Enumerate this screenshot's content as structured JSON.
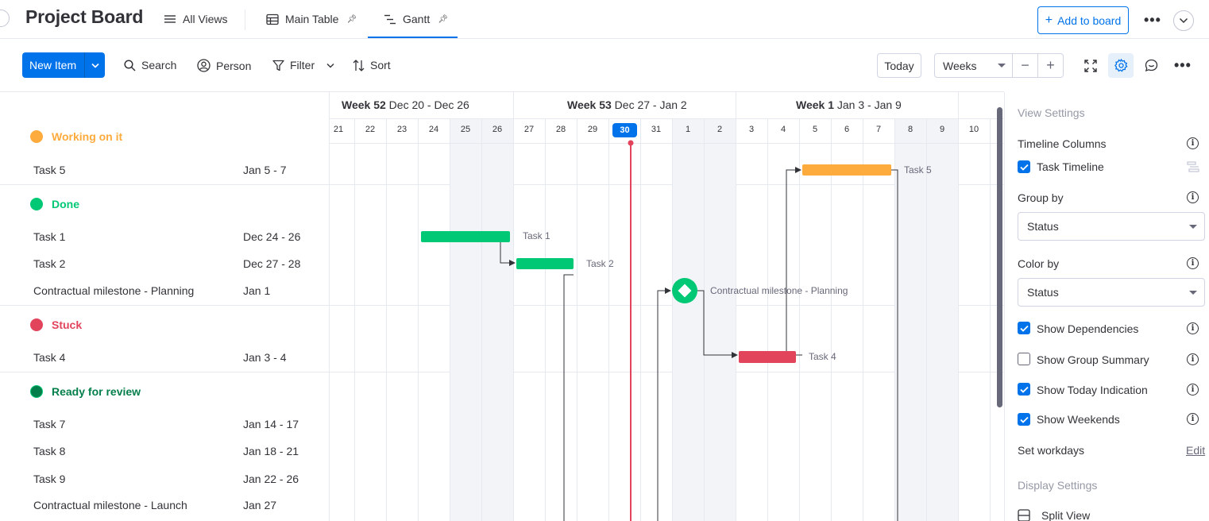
{
  "header": {
    "title": "Project Board",
    "views": [
      {
        "label": "All Views"
      },
      {
        "label": "Main Table"
      },
      {
        "label": "Gantt"
      }
    ],
    "add_to_board": "Add to board"
  },
  "toolbar": {
    "new_item": "New Item",
    "search": "Search",
    "person": "Person",
    "filter": "Filter",
    "sort": "Sort",
    "today": "Today",
    "scale": "Weeks"
  },
  "weeks": [
    {
      "name": "Week 52",
      "range": "Dec 20 - Dec 26"
    },
    {
      "name": "Week 53",
      "range": "Dec 27 - Jan 2"
    },
    {
      "name": "Week 1",
      "range": "Jan 3 - Jan 9"
    }
  ],
  "days": [
    "21",
    "22",
    "23",
    "24",
    "25",
    "26",
    "27",
    "28",
    "29",
    "30",
    "31",
    "1",
    "2",
    "3",
    "4",
    "5",
    "6",
    "7",
    "8",
    "9",
    "10"
  ],
  "today_day": "30",
  "groups": [
    {
      "name": "Working on it",
      "color": "#fdab3d",
      "items": [
        {
          "name": "Task 5",
          "date": "Jan 5 - 7"
        }
      ]
    },
    {
      "name": "Done",
      "color": "#00c875",
      "items": [
        {
          "name": "Task 1",
          "date": "Dec 24 - 26"
        },
        {
          "name": "Task 2",
          "date": "Dec 27 - 28"
        },
        {
          "name": "Contractual milestone - Planning",
          "date": "Jan 1"
        }
      ]
    },
    {
      "name": "Stuck",
      "color": "#e2445c",
      "items": [
        {
          "name": "Task 4",
          "date": "Jan 3 - 4"
        }
      ]
    },
    {
      "name": "Ready for review",
      "color": "#037f4c",
      "items": [
        {
          "name": "Task 7",
          "date": "Jan 14 - 17"
        },
        {
          "name": "Task 8",
          "date": "Jan 18 - 21"
        },
        {
          "name": "Task 9",
          "date": "Jan 22 - 26"
        },
        {
          "name": "Contractual milestone - Launch",
          "date": "Jan 27"
        }
      ]
    }
  ],
  "bars": {
    "task5": {
      "label": "Task 5",
      "color": "#fdab3d"
    },
    "task1": {
      "label": "Task 1",
      "color": "#00c875"
    },
    "task2": {
      "label": "Task 2",
      "color": "#00c875"
    },
    "milestone": {
      "label": "Contractual milestone - Planning",
      "color": "#00c875"
    },
    "task4": {
      "label": "Task 4",
      "color": "#e2445c"
    }
  },
  "today_line_color": "#e2445c",
  "panel": {
    "view_settings": "View Settings",
    "timeline_columns": "Timeline Columns",
    "task_timeline": "Task Timeline",
    "group_by": "Group by",
    "group_by_value": "Status",
    "color_by": "Color by",
    "color_by_value": "Status",
    "show_dependencies": "Show Dependencies",
    "show_group_summary": "Show Group Summary",
    "show_today": "Show Today Indication",
    "show_weekends": "Show Weekends",
    "set_workdays": "Set workdays",
    "edit": "Edit",
    "display_settings": "Display Settings",
    "split_view": "Split View"
  }
}
